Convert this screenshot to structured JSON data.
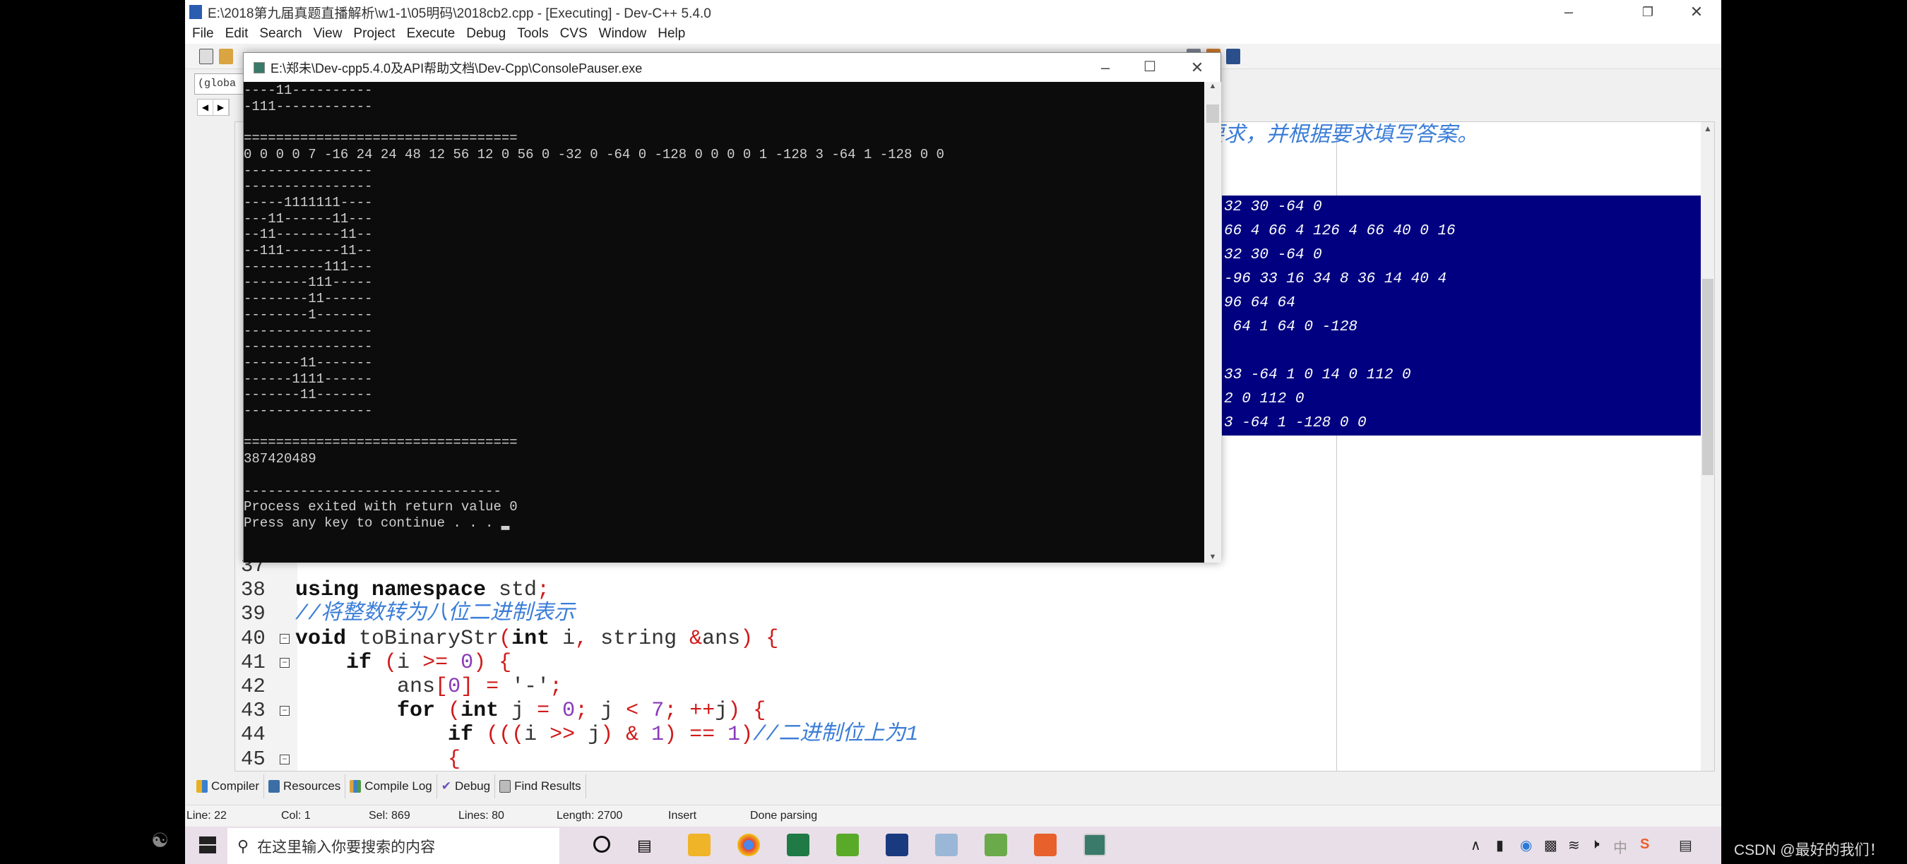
{
  "window": {
    "title": "E:\\2018第九届真题直播解析\\w1-1\\05明码\\2018cb2.cpp - [Executing] - Dev-C++ 5.4.0",
    "minimize": "–",
    "restore": "❐",
    "close": "✕"
  },
  "menu": [
    "File",
    "Edit",
    "Search",
    "View",
    "Project",
    "Execute",
    "Debug",
    "Tools",
    "CVS",
    "Window",
    "Help"
  ],
  "toolbar": {
    "scope_box": "(globa"
  },
  "tab_arrows": {
    "left": "◀",
    "right": "▶"
  },
  "console": {
    "title": "E:\\郑未\\Dev-cpp5.4.0及API帮助文档\\Dev-Cpp\\ConsolePauser.exe",
    "minimize": "–",
    "maximize": "☐",
    "close": "✕",
    "lines": [
      "----11----------",
      "-111------------",
      "",
      "==================================",
      "0 0 0 0 7 -16 24 24 48 12 56 12 0 56 0 -32 0 -64 0 -128 0 0 0 0 1 -128 3 -64 1 -128 0 0",
      "----------------",
      "----------------",
      "-----1111111----",
      "---11------11---",
      "--11--------11--",
      "--111-------11--",
      "----------111---",
      "--------111-----",
      "--------11------",
      "--------1-------",
      "----------------",
      "----------------",
      "-------11-------",
      "------1111------",
      "-------11-------",
      "----------------",
      "",
      "==================================",
      "387420489",
      "",
      "--------------------------------",
      "Process exited with return value 0",
      "Press any key to continue . . . ▂"
    ]
  },
  "editor": {
    "header_comment": "的要求，并根据要求填写答案。",
    "selected_lines": [
      "32 30 -64 0",
      "66 4 66 4 126 4 66 40 0 16",
      "32 30 -64 0",
      "-96 33 16 34 8 36 14 40 4",
      "96 64 64",
      " 64 1 64 0 -128",
      "",
      "33 -64 1 0 14 0 112 0",
      "2 0 112 0",
      "3 -64 1 -128 0 0"
    ],
    "code": [
      {
        "num": "37",
        "fold": false,
        "tokens": []
      },
      {
        "num": "38",
        "fold": false,
        "tokens": [
          [
            "using namespace",
            "kw"
          ],
          [
            " std",
            "tx"
          ],
          [
            ";",
            "pn"
          ]
        ]
      },
      {
        "num": "39",
        "fold": false,
        "tokens": [
          [
            "//将整数转为八位二进制表示",
            "cm"
          ]
        ]
      },
      {
        "num": "40",
        "fold": true,
        "tokens": [
          [
            "void",
            "kw"
          ],
          [
            " toBinaryStr",
            "tx"
          ],
          [
            "(",
            "pn"
          ],
          [
            "int",
            "kw"
          ],
          [
            " i",
            "tx"
          ],
          [
            ",",
            "pn"
          ],
          [
            " string ",
            "tx"
          ],
          [
            "&",
            "pn"
          ],
          [
            "ans",
            "tx"
          ],
          [
            ") {",
            "pn"
          ]
        ]
      },
      {
        "num": "41",
        "fold": true,
        "tokens": [
          [
            "    ",
            "tx"
          ],
          [
            "if",
            "kw"
          ],
          [
            " (",
            "pn"
          ],
          [
            "i ",
            "tx"
          ],
          [
            ">=",
            "pn"
          ],
          [
            " ",
            "tx"
          ],
          [
            "0",
            "nm"
          ],
          [
            ") {",
            "pn"
          ]
        ]
      },
      {
        "num": "42",
        "fold": false,
        "tokens": [
          [
            "        ans",
            "tx"
          ],
          [
            "[",
            "pn"
          ],
          [
            "0",
            "nm"
          ],
          [
            "]",
            "pn"
          ],
          [
            " = ",
            "pn"
          ],
          [
            "'-'",
            "tx"
          ],
          [
            ";",
            "pn"
          ]
        ]
      },
      {
        "num": "43",
        "fold": true,
        "tokens": [
          [
            "        ",
            "tx"
          ],
          [
            "for",
            "kw"
          ],
          [
            " (",
            "pn"
          ],
          [
            "int",
            "kw"
          ],
          [
            " j ",
            "tx"
          ],
          [
            "=",
            "pn"
          ],
          [
            " ",
            "tx"
          ],
          [
            "0",
            "nm"
          ],
          [
            "; ",
            "pn"
          ],
          [
            "j ",
            "tx"
          ],
          [
            "<",
            "pn"
          ],
          [
            " ",
            "tx"
          ],
          [
            "7",
            "nm"
          ],
          [
            "; ++",
            "pn"
          ],
          [
            "j",
            "tx"
          ],
          [
            ") {",
            "pn"
          ]
        ]
      },
      {
        "num": "44",
        "fold": false,
        "tokens": [
          [
            "            ",
            "tx"
          ],
          [
            "if",
            "kw"
          ],
          [
            " (((",
            "pn"
          ],
          [
            "i ",
            "tx"
          ],
          [
            ">>",
            "pn"
          ],
          [
            " j",
            "tx"
          ],
          [
            ") & ",
            "pn"
          ],
          [
            "1",
            "nm"
          ],
          [
            ") == ",
            "pn"
          ],
          [
            "1",
            "nm"
          ],
          [
            ")",
            "pn"
          ],
          [
            "//二进制位上为1",
            "cm"
          ]
        ]
      },
      {
        "num": "45",
        "fold": true,
        "tokens": [
          [
            "            ",
            "tx"
          ],
          [
            "{",
            "pn"
          ]
        ]
      }
    ]
  },
  "bottom_tabs": [
    "Compiler",
    "Resources",
    "Compile Log",
    "Debug",
    "Find Results"
  ],
  "status": {
    "line": "Line:  22",
    "col": "Col:  1",
    "sel": "Sel:  869",
    "lines": "Lines:  80",
    "length": "Length:  2700",
    "mode": "Insert",
    "parse": "Done parsing"
  },
  "taskbar": {
    "search_placeholder": "在这里输入你要搜索的内容",
    "tray": {
      "chevron": "∧",
      "ime": "中"
    }
  },
  "watermark": "CSDN @最好的我们！",
  "colors": {
    "selection": "#000080",
    "keyword": "#111111",
    "punct": "#d01a1a",
    "number": "#8a3ab9",
    "comment": "#3b7dd8",
    "console_bg": "#0c0c0c"
  }
}
